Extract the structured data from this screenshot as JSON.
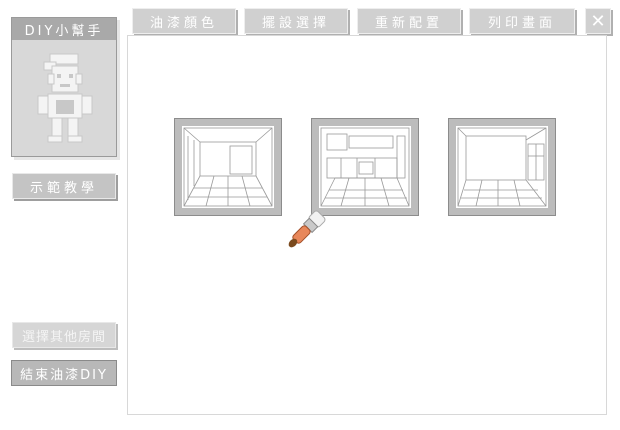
{
  "tabs": [
    {
      "label": "油漆顏色"
    },
    {
      "label": "擺設選擇"
    },
    {
      "label": "重新配置"
    },
    {
      "label": "列印畫面"
    }
  ],
  "close_icon": "close-icon",
  "helper": {
    "title": "DIY小幫手",
    "icon": "painter-character-icon"
  },
  "sidebar": {
    "tutorial": "示範教學",
    "other_rooms": "選擇其他房間",
    "exit": "結束油漆DIY"
  },
  "rooms": [
    {
      "icon": "empty-room-icon"
    },
    {
      "icon": "kitchen-room-icon"
    },
    {
      "icon": "living-room-icon"
    }
  ],
  "cursor_icon": "paintbrush-cursor-icon",
  "colors": {
    "button_gray": "#c4c4c4",
    "panel_border": "#d8d8d8",
    "brush_orange": "#e8875a"
  }
}
